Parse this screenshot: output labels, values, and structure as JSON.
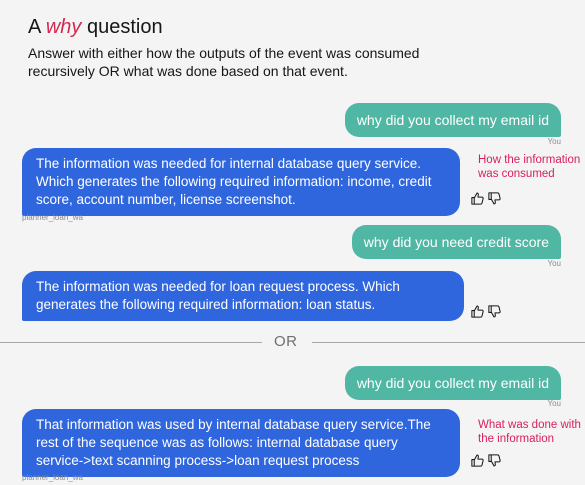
{
  "header": {
    "title_prefix": "A",
    "title_emphasis": "why",
    "title_suffix": "question",
    "description": "Answer with either how the outputs of the event was consumed recursively OR what was done based on that event."
  },
  "conversation1": {
    "msg1": "why did you collect my email id",
    "you1": "You",
    "reply1": "The information was needed for internal database query service. Which generates the following required information: income, credit score, account number, license screenshot.",
    "sender1": "planner_loan_wa",
    "annotation": "How the information was consumed",
    "msg2": "why did you need credit score",
    "you2": "You",
    "reply2": "The information was needed for loan request process. Which generates the following required information: loan status."
  },
  "divider": {
    "label": "OR"
  },
  "conversation2": {
    "msg1": "why did you collect my email id",
    "you1": "You",
    "reply1": "That information was used by internal database query service.The rest of the sequence was as follows: internal database query service->text scanning process->loan request process",
    "sender1": "planner_loan_wa",
    "annotation": "What was done with the information"
  },
  "colors": {
    "accent": "#d1294f",
    "user_bubble": "#4fb7a4",
    "bot_bubble": "#2f66de"
  }
}
